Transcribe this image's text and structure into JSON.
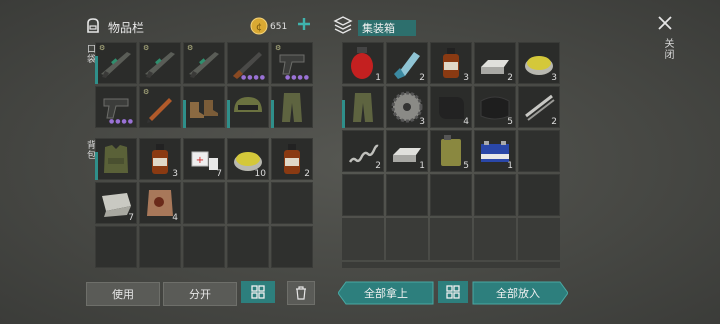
{
  "inventory": {
    "title": "物品栏",
    "coin_count": "651",
    "section_labels": [
      "口袋",
      "背包"
    ]
  },
  "container": {
    "title": "集装箱"
  },
  "close_label": "关闭",
  "buttons": {
    "use": "使用",
    "split": "分开",
    "take_all": "全部拿上",
    "put_all": "全部放入"
  },
  "pocket_slots": [
    {
      "icon": "rifle-icon",
      "qty": ""
    },
    {
      "icon": "rifle-icon",
      "qty": ""
    },
    {
      "icon": "rifle-icon",
      "qty": ""
    },
    {
      "icon": "shotgun-icon",
      "qty": "",
      "dots": "●●●●"
    },
    {
      "icon": "pistol-icon",
      "qty": "",
      "dots": "●●●●"
    },
    {
      "icon": "pistol-icon",
      "qty": "",
      "dots": "●●●●"
    },
    {
      "icon": "flare-icon",
      "qty": ""
    },
    {
      "icon": "boots-icon",
      "qty": ""
    },
    {
      "icon": "helmet-icon",
      "qty": ""
    },
    {
      "icon": "pants-icon",
      "qty": ""
    }
  ],
  "backpack_slots": [
    {
      "icon": "vest-icon",
      "qty": ""
    },
    {
      "icon": "bottle-icon",
      "qty": "3"
    },
    {
      "icon": "pills-icon",
      "qty": "7"
    },
    {
      "icon": "tin-icon",
      "qty": "10"
    },
    {
      "icon": "bottle-icon",
      "qty": "2"
    },
    {
      "icon": "cloth-icon",
      "qty": "7"
    },
    {
      "icon": "leather-icon",
      "qty": "4"
    }
  ],
  "container_slots": [
    {
      "icon": "gas-canister-icon",
      "qty": "1"
    },
    {
      "icon": "inhaler-icon",
      "qty": "2"
    },
    {
      "icon": "bottle-icon",
      "qty": "3"
    },
    {
      "icon": "ingot-icon",
      "qty": "2"
    },
    {
      "icon": "tin-icon",
      "qty": "3"
    },
    {
      "icon": "pants-icon",
      "qty": ""
    },
    {
      "icon": "saw-blade-icon",
      "qty": "3"
    },
    {
      "icon": "metal-plate-icon",
      "qty": "4"
    },
    {
      "icon": "rubber-icon",
      "qty": "5"
    },
    {
      "icon": "pipes-icon",
      "qty": "2"
    },
    {
      "icon": "spring-icon",
      "qty": "2"
    },
    {
      "icon": "ingot-icon",
      "qty": "1"
    },
    {
      "icon": "jerrycan-icon",
      "qty": "5"
    },
    {
      "icon": "battery-icon",
      "qty": "1"
    }
  ],
  "colors": {
    "accent_teal": "#2d7f7d",
    "coin_gold": "#d9a933",
    "rarity_purple": "#9a72d6"
  }
}
